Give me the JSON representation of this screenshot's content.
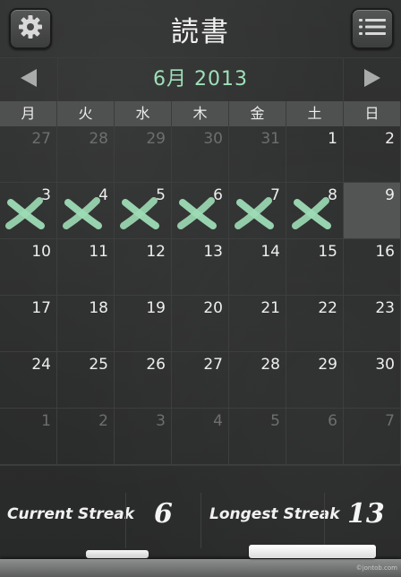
{
  "header": {
    "title": "読書",
    "settings_icon": "gear-icon",
    "menu_icon": "list-icon"
  },
  "month_nav": {
    "label": "6月 2013",
    "prev_icon": "triangle-left-icon",
    "next_icon": "triangle-right-icon"
  },
  "weekdays": [
    "月",
    "火",
    "水",
    "木",
    "金",
    "土",
    "日"
  ],
  "calendar": {
    "weeks": [
      [
        {
          "day": "27",
          "other": true
        },
        {
          "day": "28",
          "other": true
        },
        {
          "day": "29",
          "other": true
        },
        {
          "day": "30",
          "other": true
        },
        {
          "day": "31",
          "other": true
        },
        {
          "day": "1"
        },
        {
          "day": "2"
        }
      ],
      [
        {
          "day": "3",
          "done": true
        },
        {
          "day": "4",
          "done": true
        },
        {
          "day": "5",
          "done": true
        },
        {
          "day": "6",
          "done": true
        },
        {
          "day": "7",
          "done": true
        },
        {
          "day": "8",
          "done": true
        },
        {
          "day": "9",
          "today": true
        }
      ],
      [
        {
          "day": "10"
        },
        {
          "day": "11"
        },
        {
          "day": "12"
        },
        {
          "day": "13"
        },
        {
          "day": "14"
        },
        {
          "day": "15"
        },
        {
          "day": "16"
        }
      ],
      [
        {
          "day": "17"
        },
        {
          "day": "18"
        },
        {
          "day": "19"
        },
        {
          "day": "20"
        },
        {
          "day": "21"
        },
        {
          "day": "22"
        },
        {
          "day": "23"
        }
      ],
      [
        {
          "day": "24"
        },
        {
          "day": "25"
        },
        {
          "day": "26"
        },
        {
          "day": "27"
        },
        {
          "day": "28"
        },
        {
          "day": "29"
        },
        {
          "day": "30"
        }
      ],
      [
        {
          "day": "1",
          "other": true
        },
        {
          "day": "2",
          "other": true
        },
        {
          "day": "3",
          "other": true
        },
        {
          "day": "4",
          "other": true
        },
        {
          "day": "5",
          "other": true
        },
        {
          "day": "6",
          "other": true
        },
        {
          "day": "7",
          "other": true
        }
      ]
    ],
    "mark_color": "#9ddcb5"
  },
  "stats": {
    "current_label": "Current Streak",
    "current_value": "6",
    "longest_label": "Longest Streak",
    "longest_value": "13"
  },
  "watermark": "©jontob.com"
}
